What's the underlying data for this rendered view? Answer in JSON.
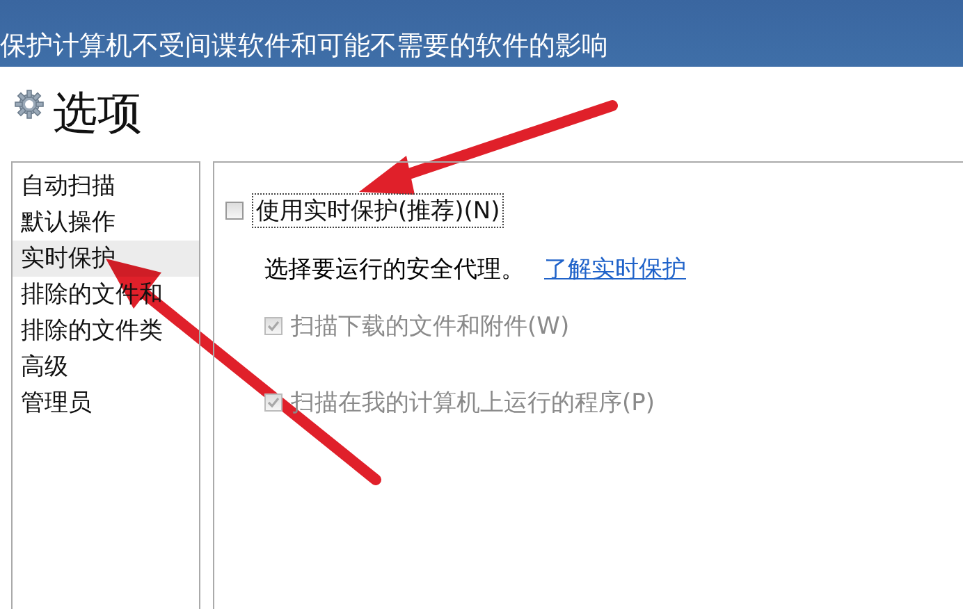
{
  "header": {
    "subtitle": "保护计算机不受间谍软件和可能不需要的软件的影响"
  },
  "page": {
    "title": "选项"
  },
  "sidebar": {
    "items": [
      {
        "label": "自动扫描",
        "selected": false
      },
      {
        "label": "默认操作",
        "selected": false
      },
      {
        "label": "实时保护",
        "selected": true
      },
      {
        "label": "排除的文件和",
        "selected": false
      },
      {
        "label": "排除的文件类",
        "selected": false
      },
      {
        "label": "高级",
        "selected": false
      },
      {
        "label": "管理员",
        "selected": false
      }
    ]
  },
  "options": {
    "main": {
      "label": "使用实时保护(推荐)(N)",
      "checked": false
    },
    "agent_text": "选择要运行的安全代理。",
    "link": "了解实时保护",
    "agents": [
      {
        "label": "扫描下载的文件和附件(W)",
        "checked": true,
        "disabled": true
      },
      {
        "label": "扫描在我的计算机上运行的程序(P)",
        "checked": true,
        "disabled": true
      }
    ]
  }
}
